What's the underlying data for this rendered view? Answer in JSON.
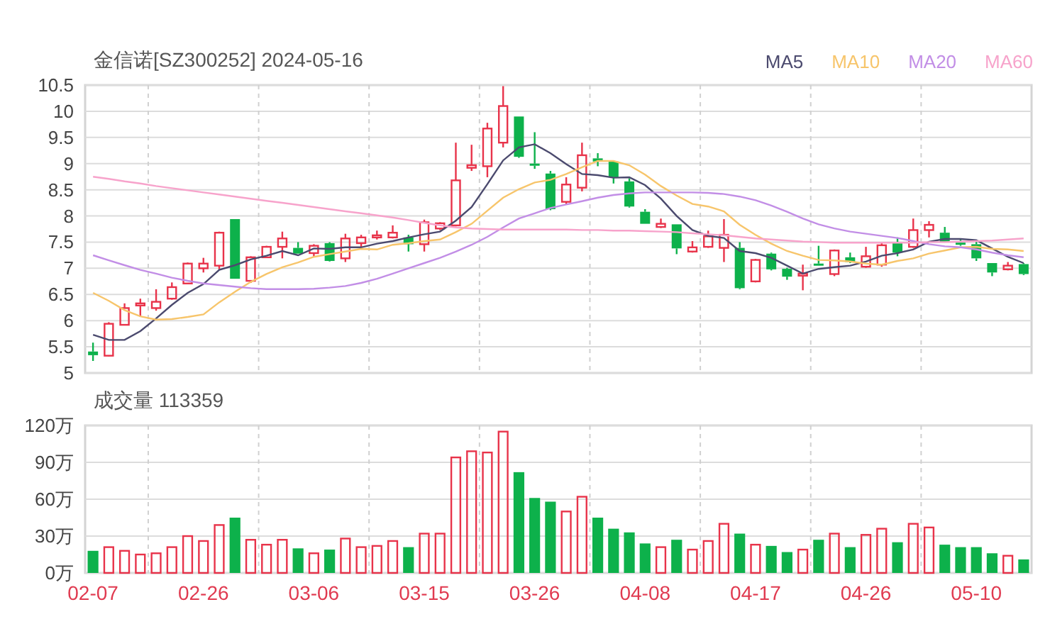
{
  "header": {
    "title": "金信诺[SZ300252] 2024-05-16"
  },
  "price_chart": {
    "chart_data": {
      "type": "candlestick",
      "grid": true,
      "ylim": [
        5,
        10.5
      ],
      "yticks": [
        5,
        5.5,
        6,
        6.5,
        7,
        7.5,
        8,
        8.5,
        9,
        9.5,
        10,
        10.5
      ],
      "categories": [
        null,
        null,
        null,
        null,
        null,
        null,
        null,
        null,
        null,
        null,
        null,
        null,
        null,
        null,
        null,
        null,
        null,
        null,
        null,
        null,
        null,
        null,
        null,
        null,
        null,
        null,
        null,
        null,
        null,
        null,
        null,
        null,
        null,
        null,
        null,
        null,
        null,
        null,
        null,
        null,
        null,
        null,
        null,
        null,
        null,
        null,
        null,
        null,
        null,
        null,
        null,
        null,
        null,
        null,
        null,
        null,
        null,
        null,
        null,
        null
      ],
      "series": [
        {
          "name": "MA5",
          "type": "line",
          "color": "#4b4a6e",
          "values": [
            5.73,
            5.63,
            5.63,
            5.8,
            6.04,
            6.3,
            6.53,
            6.7,
            6.97,
            7.06,
            7.17,
            7.24,
            7.33,
            7.25,
            7.38,
            7.37,
            7.4,
            7.4,
            7.47,
            7.52,
            7.59,
            7.65,
            7.7,
            7.91,
            8.17,
            8.61,
            9.06,
            9.31,
            9.37,
            9.2,
            8.99,
            8.8,
            8.78,
            8.73,
            8.74,
            8.59,
            8.33,
            8.0,
            7.73,
            7.62,
            7.58,
            7.33,
            7.29,
            7.2,
            7.05,
            6.9,
            6.99,
            7.02,
            7.05,
            7.13,
            7.24,
            7.29,
            7.36,
            7.51,
            7.56,
            7.56,
            7.54,
            7.38,
            7.22,
            7.1
          ]
        },
        {
          "name": "MA10",
          "type": "line",
          "color": "#f7c56b",
          "values": [
            6.53,
            6.38,
            6.2,
            6.08,
            6.02,
            6.03,
            6.07,
            6.12,
            6.35,
            6.55,
            6.74,
            6.89,
            7.02,
            7.11,
            7.22,
            7.27,
            7.32,
            7.37,
            7.36,
            7.45,
            7.48,
            7.52,
            7.55,
            7.69,
            7.85,
            8.1,
            8.35,
            8.51,
            8.64,
            8.69,
            8.8,
            8.93,
            9.05,
            9.05,
            8.97,
            8.79,
            8.57,
            8.39,
            8.23,
            8.18,
            8.09,
            7.83,
            7.64,
            7.47,
            7.33,
            7.24,
            7.16,
            7.15,
            7.13,
            7.09,
            7.07,
            7.14,
            7.19,
            7.28,
            7.34,
            7.4,
            7.41,
            7.37,
            7.36,
            7.33
          ]
        },
        {
          "name": "MA20",
          "type": "line",
          "color": "#c28ee6",
          "values": [
            7.25,
            7.15,
            7.06,
            6.97,
            6.9,
            6.82,
            6.76,
            6.71,
            6.68,
            6.65,
            6.62,
            6.6,
            6.6,
            6.6,
            6.61,
            6.63,
            6.66,
            6.72,
            6.8,
            6.9,
            7.0,
            7.1,
            7.2,
            7.32,
            7.45,
            7.6,
            7.78,
            7.95,
            8.05,
            8.15,
            8.22,
            8.28,
            8.35,
            8.4,
            8.43,
            8.45,
            8.45,
            8.45,
            8.45,
            8.44,
            8.42,
            8.37,
            8.3,
            8.2,
            8.08,
            7.95,
            7.84,
            7.76,
            7.7,
            7.66,
            7.62,
            7.58,
            7.52,
            7.46,
            7.42,
            7.4,
            7.36,
            7.3,
            7.25,
            7.21
          ]
        },
        {
          "name": "MA60",
          "type": "line",
          "color": "#f7a3cb",
          "values": [
            8.75,
            8.71,
            8.66,
            8.62,
            8.57,
            8.53,
            8.49,
            8.45,
            8.41,
            8.37,
            8.33,
            8.29,
            8.25,
            8.21,
            8.17,
            8.13,
            8.09,
            8.05,
            8.01,
            7.97,
            7.92,
            7.87,
            7.82,
            7.78,
            7.76,
            7.75,
            7.74,
            7.74,
            7.74,
            7.74,
            7.74,
            7.73,
            7.73,
            7.72,
            7.72,
            7.71,
            7.7,
            7.69,
            7.67,
            7.65,
            7.63,
            7.6,
            7.57,
            7.55,
            7.53,
            7.51,
            7.5,
            7.49,
            7.49,
            7.49,
            7.49,
            7.49,
            7.49,
            7.5,
            7.5,
            7.51,
            7.52,
            7.53,
            7.55,
            7.57
          ]
        }
      ],
      "ohlc": [
        [
          5.41,
          5.58,
          5.23,
          5.34
        ],
        [
          5.33,
          5.97,
          5.32,
          5.94
        ],
        [
          5.92,
          6.33,
          5.92,
          6.24
        ],
        [
          6.29,
          6.42,
          6.07,
          6.33
        ],
        [
          6.24,
          6.6,
          6.19,
          6.36
        ],
        [
          6.42,
          6.73,
          6.4,
          6.64
        ],
        [
          6.71,
          7.11,
          6.71,
          7.09
        ],
        [
          7.0,
          7.2,
          6.92,
          7.09
        ],
        [
          7.05,
          7.7,
          6.98,
          7.68
        ],
        [
          7.94,
          7.94,
          6.8,
          6.8
        ],
        [
          6.76,
          7.23,
          6.72,
          7.21
        ],
        [
          7.21,
          7.43,
          7.21,
          7.41
        ],
        [
          7.41,
          7.7,
          7.19,
          7.57
        ],
        [
          7.39,
          7.5,
          7.28,
          7.28
        ],
        [
          7.29,
          7.46,
          7.21,
          7.43
        ],
        [
          7.48,
          7.5,
          7.13,
          7.14
        ],
        [
          7.19,
          7.66,
          7.12,
          7.57
        ],
        [
          7.48,
          7.64,
          7.39,
          7.59
        ],
        [
          7.59,
          7.72,
          7.55,
          7.63
        ],
        [
          7.59,
          7.82,
          7.57,
          7.68
        ],
        [
          7.59,
          7.64,
          7.32,
          7.46
        ],
        [
          7.46,
          7.93,
          7.32,
          7.88
        ],
        [
          7.76,
          7.88,
          7.73,
          7.86
        ],
        [
          7.82,
          9.4,
          7.8,
          8.68
        ],
        [
          8.92,
          9.36,
          8.86,
          8.97
        ],
        [
          8.95,
          9.78,
          8.74,
          9.67
        ],
        [
          9.4,
          10.48,
          9.31,
          10.1
        ],
        [
          9.9,
          9.9,
          9.11,
          9.13
        ],
        [
          9.0,
          9.6,
          8.9,
          8.98
        ],
        [
          8.81,
          8.86,
          8.11,
          8.13
        ],
        [
          8.27,
          8.74,
          8.22,
          8.6
        ],
        [
          8.54,
          9.4,
          8.47,
          9.16
        ],
        [
          9.1,
          9.2,
          8.95,
          9.04
        ],
        [
          9.04,
          9.04,
          8.62,
          8.74
        ],
        [
          8.66,
          8.72,
          8.16,
          8.18
        ],
        [
          8.08,
          8.13,
          7.85,
          7.85
        ],
        [
          7.79,
          7.95,
          7.77,
          7.85
        ],
        [
          7.84,
          7.84,
          7.27,
          7.38
        ],
        [
          7.32,
          7.52,
          7.3,
          7.4
        ],
        [
          7.41,
          7.72,
          7.39,
          7.61
        ],
        [
          7.39,
          7.94,
          7.12,
          7.64
        ],
        [
          7.39,
          7.5,
          6.6,
          6.62
        ],
        [
          6.75,
          7.18,
          6.73,
          7.16
        ],
        [
          7.28,
          7.3,
          6.96,
          6.98
        ],
        [
          6.99,
          7.01,
          6.78,
          6.84
        ],
        [
          6.88,
          7.07,
          6.58,
          6.9
        ],
        [
          7.09,
          7.43,
          7.05,
          7.05
        ],
        [
          6.89,
          7.36,
          6.85,
          7.34
        ],
        [
          7.21,
          7.3,
          7.1,
          7.12
        ],
        [
          7.03,
          7.41,
          7.01,
          7.23
        ],
        [
          7.07,
          7.5,
          7.03,
          7.44
        ],
        [
          7.49,
          7.59,
          7.23,
          7.3
        ],
        [
          7.41,
          7.95,
          7.39,
          7.73
        ],
        [
          7.73,
          7.9,
          7.59,
          7.83
        ],
        [
          7.68,
          7.79,
          7.5,
          7.5
        ],
        [
          7.49,
          7.57,
          7.43,
          7.45
        ],
        [
          7.46,
          7.51,
          7.14,
          7.19
        ],
        [
          7.1,
          7.1,
          6.85,
          6.92
        ],
        [
          6.98,
          7.12,
          6.96,
          7.05
        ],
        [
          7.08,
          7.1,
          6.87,
          6.89
        ]
      ]
    }
  },
  "volume_chart": {
    "title": "成交量 113359",
    "chart_data": {
      "type": "bar",
      "grid": true,
      "ylim": [
        0,
        120
      ],
      "yticks": [
        {
          "value": 0,
          "label": "0万"
        },
        {
          "value": 30,
          "label": "30万"
        },
        {
          "value": 60,
          "label": "60万"
        },
        {
          "value": 90,
          "label": "90万"
        },
        {
          "value": 120,
          "label": "120万"
        }
      ],
      "categories": [
        "02-07",
        null,
        null,
        null,
        null,
        null,
        null,
        "02-26",
        null,
        null,
        null,
        null,
        null,
        null,
        "03-06",
        null,
        null,
        null,
        null,
        null,
        null,
        "03-15",
        null,
        null,
        null,
        null,
        null,
        null,
        "03-26",
        null,
        null,
        null,
        null,
        null,
        null,
        "04-08",
        null,
        null,
        null,
        null,
        null,
        null,
        "04-17",
        null,
        null,
        null,
        null,
        null,
        null,
        "04-26",
        null,
        null,
        null,
        null,
        null,
        null,
        "05-10",
        null,
        null,
        null
      ],
      "series": [
        {
          "values": [
            18,
            21,
            18,
            15,
            16,
            21,
            30,
            26,
            39,
            45,
            27,
            23,
            27,
            20,
            16,
            19,
            28,
            21,
            22,
            26,
            21,
            32,
            32,
            94,
            99,
            98,
            115,
            82,
            61,
            58,
            50,
            62,
            45,
            36,
            33,
            24,
            21,
            27,
            19,
            26,
            40,
            32,
            23,
            22,
            17,
            19,
            27,
            32,
            21,
            31,
            36,
            25,
            40,
            37,
            23,
            21,
            21,
            16,
            14,
            11
          ]
        }
      ]
    }
  }
}
